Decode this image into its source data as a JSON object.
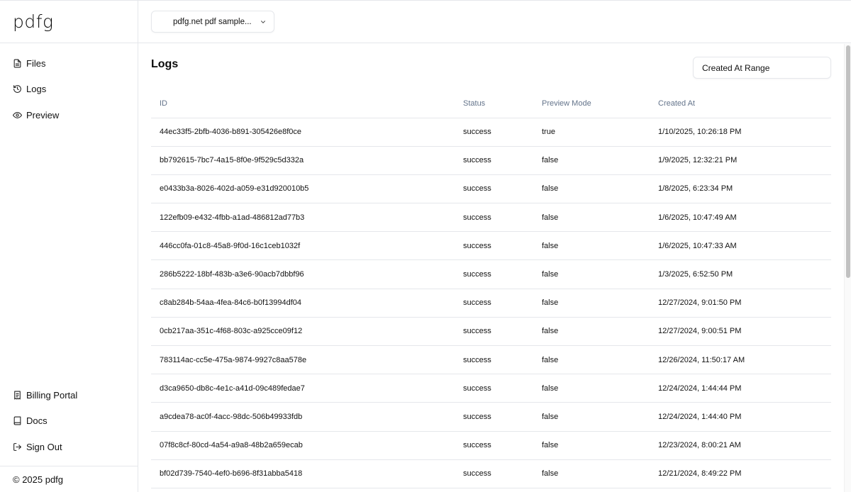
{
  "brand": {
    "logo": "pdfg",
    "footer": "© 2025 pdfg"
  },
  "sidebar": {
    "top_items": [
      {
        "label": "Files",
        "icon": "file-text-icon"
      },
      {
        "label": "Logs",
        "icon": "history-icon"
      },
      {
        "label": "Preview",
        "icon": "eye-icon"
      }
    ],
    "bottom_items": [
      {
        "label": "Billing Portal",
        "icon": "receipt-icon"
      },
      {
        "label": "Docs",
        "icon": "book-icon"
      },
      {
        "label": "Sign Out",
        "icon": "log-out-icon"
      }
    ]
  },
  "topbar": {
    "project_select": "pdfg.net pdf sample..."
  },
  "main": {
    "title": "Logs",
    "range_button": "Created At Range",
    "table": {
      "headers": [
        "ID",
        "Status",
        "Preview Mode",
        "Created At"
      ],
      "rows": [
        [
          "44ec33f5-2bfb-4036-b891-305426e8f0ce",
          "success",
          "true",
          "1/10/2025, 10:26:18 PM"
        ],
        [
          "bb792615-7bc7-4a15-8f0e-9f529c5d332a",
          "success",
          "false",
          "1/9/2025, 12:32:21 PM"
        ],
        [
          "e0433b3a-8026-402d-a059-e31d920010b5",
          "success",
          "false",
          "1/8/2025, 6:23:34 PM"
        ],
        [
          "122efb09-e432-4fbb-a1ad-486812ad77b3",
          "success",
          "false",
          "1/6/2025, 10:47:49 AM"
        ],
        [
          "446cc0fa-01c8-45a8-9f0d-16c1ceb1032f",
          "success",
          "false",
          "1/6/2025, 10:47:33 AM"
        ],
        [
          "286b5222-18bf-483b-a3e6-90acb7dbbf96",
          "success",
          "false",
          "1/3/2025, 6:52:50 PM"
        ],
        [
          "c8ab284b-54aa-4fea-84c6-b0f13994df04",
          "success",
          "false",
          "12/27/2024, 9:01:50 PM"
        ],
        [
          "0cb217aa-351c-4f68-803c-a925cce09f12",
          "success",
          "false",
          "12/27/2024, 9:00:51 PM"
        ],
        [
          "783114ac-cc5e-475a-9874-9927c8aa578e",
          "success",
          "false",
          "12/26/2024, 11:50:17 AM"
        ],
        [
          "d3ca9650-db8c-4e1c-a41d-09c489fedae7",
          "success",
          "false",
          "12/24/2024, 1:44:44 PM"
        ],
        [
          "a9cdea78-ac0f-4acc-98dc-506b49933fdb",
          "success",
          "false",
          "12/24/2024, 1:44:40 PM"
        ],
        [
          "07f8c8cf-80cd-4a54-a9a8-48b2a659ecab",
          "success",
          "false",
          "12/23/2024, 8:00:21 AM"
        ],
        [
          "bf02d739-7540-4ef0-b696-8f31abba5418",
          "success",
          "false",
          "12/21/2024, 8:49:22 PM"
        ]
      ]
    }
  }
}
